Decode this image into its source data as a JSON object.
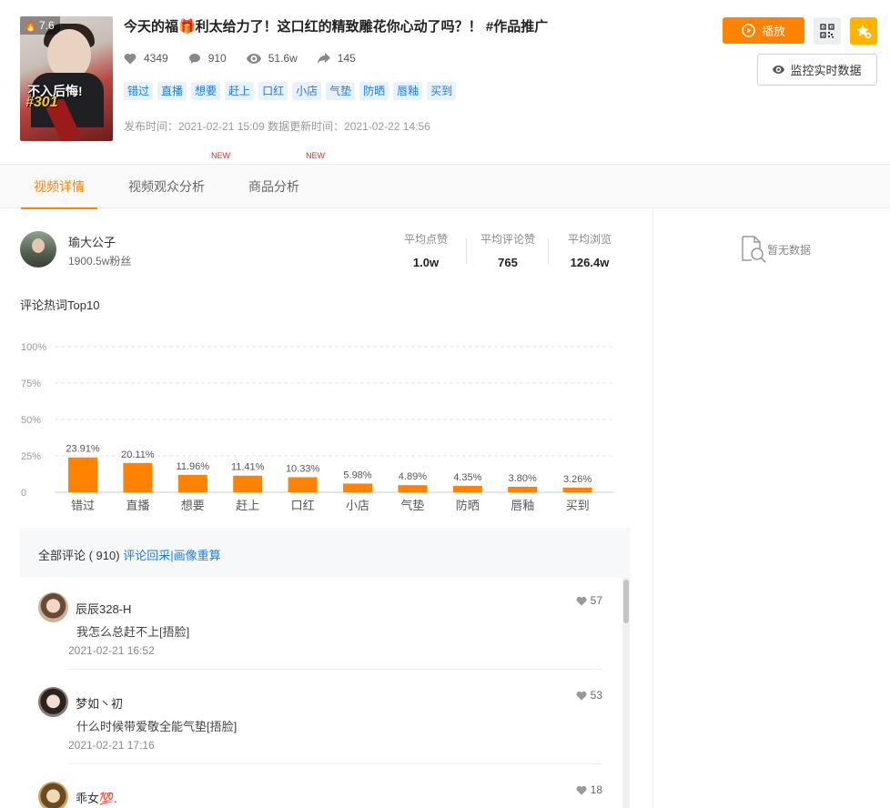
{
  "video": {
    "score": "7.6",
    "thumb_caption": "不入后悔!",
    "thumb_number": "#301",
    "title": "今天的福🎁利太给力了！这口红的精致雕花你心动了吗？！ #作品推广",
    "likes": "4349",
    "comments": "910",
    "views": "51.6w",
    "shares": "145",
    "tags": [
      "错过",
      "直播",
      "想要",
      "赶上",
      "口红",
      "小店",
      "气垫",
      "防晒",
      "唇釉",
      "买到"
    ],
    "publish_info": "发布时间：2021-02-21 15:09 数据更新时间：2021-02-22 14:56"
  },
  "actions": {
    "play_label": "播放",
    "monitor_label": "监控实时数据"
  },
  "tabs": [
    {
      "label": "视频详情",
      "new": ""
    },
    {
      "label": "视频观众分析",
      "new": "NEW"
    },
    {
      "label": "商品分析",
      "new": "NEW"
    }
  ],
  "author": {
    "name": "瑜大公子",
    "fans": "1900.5w粉丝",
    "metrics": [
      {
        "label": "平均点赞",
        "value": "1.0w"
      },
      {
        "label": "平均评论赞",
        "value": "765"
      },
      {
        "label": "平均浏览",
        "value": "126.4w"
      }
    ]
  },
  "keywords_title": "评论热词Top10",
  "chart_data": {
    "type": "bar",
    "categories": [
      "错过",
      "直播",
      "想要",
      "赶上",
      "口红",
      "小店",
      "气垫",
      "防晒",
      "唇釉",
      "买到"
    ],
    "values": [
      23.91,
      20.11,
      11.96,
      11.41,
      10.33,
      5.98,
      4.89,
      4.35,
      3.8,
      3.26
    ],
    "value_labels": [
      "23.91%",
      "20.11%",
      "11.96%",
      "11.41%",
      "10.33%",
      "5.98%",
      "4.89%",
      "4.35%",
      "3.80%",
      "3.26%"
    ],
    "ylim": [
      0,
      100
    ],
    "yticks": [
      0,
      25,
      50,
      75,
      100
    ],
    "ytick_labels": [
      "0",
      "25%",
      "50%",
      "75%",
      "100%"
    ],
    "bar_color": "#ff8200",
    "grid": true
  },
  "comments_section": {
    "header_prefix": "全部评论 ( 910)",
    "header_link": "评论回采|画像重算",
    "items": [
      {
        "name": "辰辰328-H",
        "text": "我怎么总赶不上[捂脸]",
        "time": "2021-02-21 16:52",
        "likes": "57"
      },
      {
        "name": "梦如丶初",
        "text": "什么时候带爱敬全能气垫[捂脸]",
        "time": "2021-02-21 17:16",
        "likes": "53"
      },
      {
        "name": "乖女💯.",
        "text": "",
        "time": "",
        "likes": "18"
      }
    ]
  },
  "right_panel": {
    "empty_text": "暂无数据"
  },
  "colors": {
    "accent": "#ff8200",
    "link": "#1f7bd8",
    "star": "#ffb300"
  }
}
